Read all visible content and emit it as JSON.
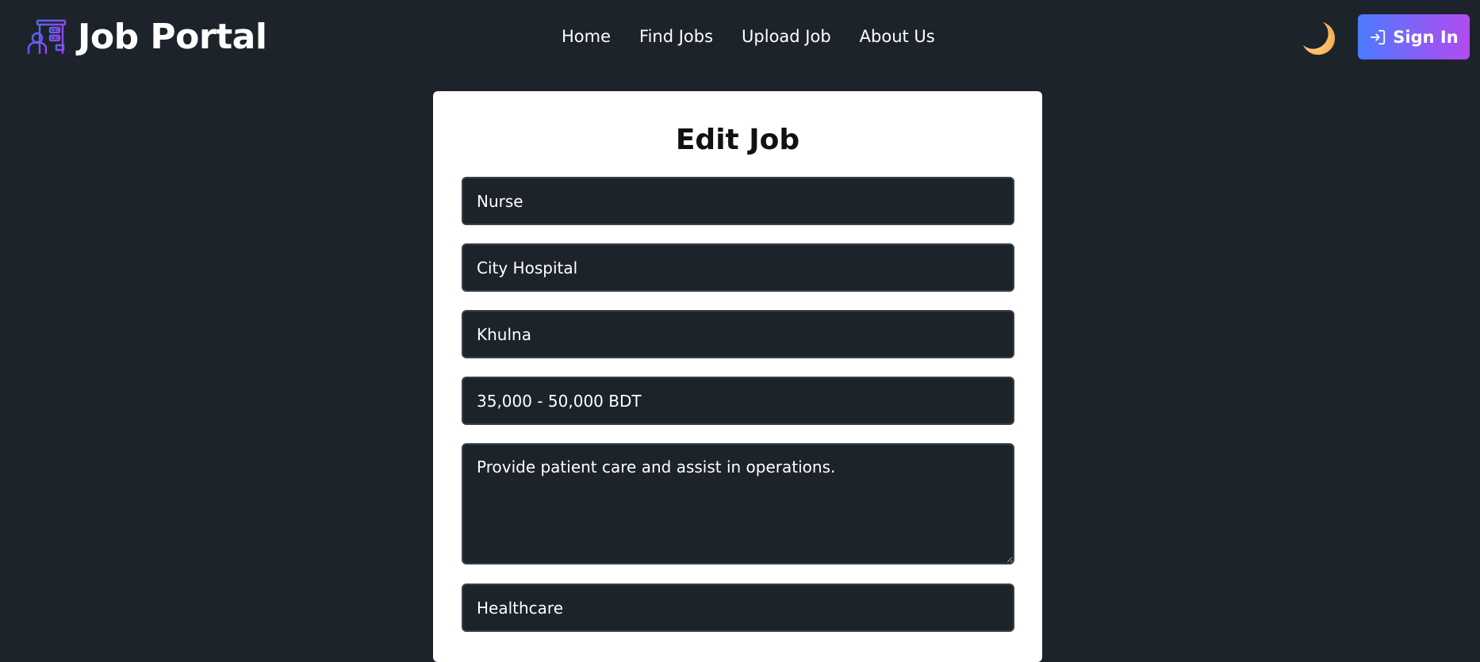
{
  "app": {
    "brand_name": "Job Portal"
  },
  "nav": {
    "links": [
      {
        "label": "Home"
      },
      {
        "label": "Find Jobs"
      },
      {
        "label": "Upload Job"
      },
      {
        "label": "About Us"
      }
    ],
    "theme_icon": "moon-icon",
    "signin_label": "Sign In",
    "signin_icon": "login-icon"
  },
  "form": {
    "title": "Edit Job",
    "job_title": "Nurse",
    "company": "City Hospital",
    "location": "Khulna",
    "salary": "35,000 - 50,000 BDT",
    "description": "Provide patient care and assist in operations.",
    "category": "Healthcare"
  },
  "colors": {
    "background": "#1d232a",
    "card": "#ffffff",
    "button_gradient_start": "#4b7bff",
    "button_gradient_end": "#b14cf0",
    "logo_accent": "#6b46e8"
  }
}
